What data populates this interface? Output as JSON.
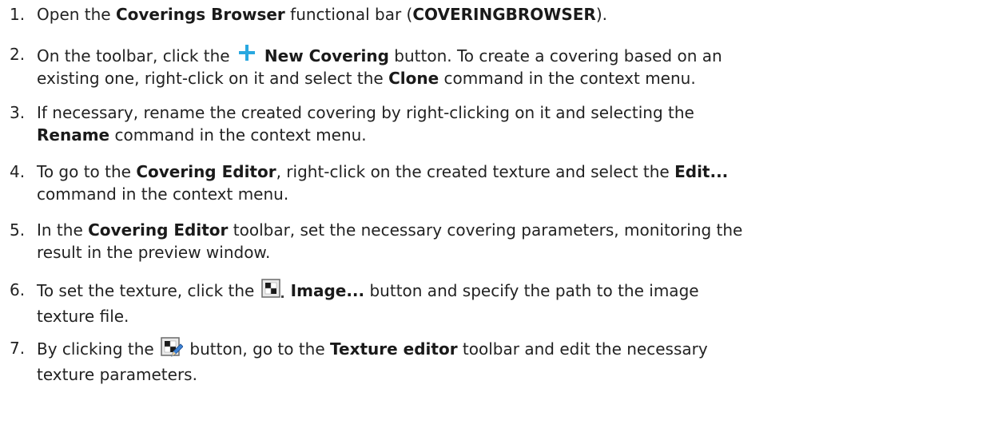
{
  "steps": [
    {
      "num": "1.",
      "lines": [
        [
          {
            "t": "Open the "
          },
          {
            "b": "Coverings Browser"
          },
          {
            "t": " functional bar ("
          },
          {
            "b": "COVERINGBROWSER"
          },
          {
            "t": ")."
          }
        ]
      ]
    },
    {
      "num": "2.",
      "lines": [
        [
          {
            "t": "On the toolbar, click the "
          },
          {
            "icon": "plus-icon"
          },
          {
            "b": " New Covering"
          },
          {
            "t": " button. To create a covering based on an"
          }
        ],
        [
          {
            "t": "existing one, right-click on it and select the "
          },
          {
            "b": "Clone"
          },
          {
            "t": " command in the context menu."
          }
        ]
      ]
    },
    {
      "num": "3.",
      "lines": [
        [
          {
            "t": "If necessary, rename the created covering by right-clicking on it and selecting the"
          }
        ],
        [
          {
            "b": "Rename"
          },
          {
            "t": " command in the context menu."
          }
        ]
      ]
    },
    {
      "num": "4.",
      "lines": [
        [
          {
            "t": "To go to the "
          },
          {
            "b": "Covering Editor"
          },
          {
            "t": ", right-click on the created texture and select the "
          },
          {
            "b": "Edit..."
          }
        ],
        [
          {
            "t": "command in the context menu."
          }
        ]
      ]
    },
    {
      "num": "5.",
      "lines": [
        [
          {
            "t": "In the "
          },
          {
            "b": "Covering Editor"
          },
          {
            "t": " toolbar, set the necessary covering parameters, monitoring the"
          }
        ],
        [
          {
            "t": "result in the preview window."
          }
        ]
      ]
    },
    {
      "num": "6.",
      "lines": [
        [
          {
            "t": "To set the texture, click the "
          },
          {
            "icon": "image-texture-icon"
          },
          {
            "b": " Image..."
          },
          {
            "t": " button and specify the path to the image"
          }
        ],
        [
          {
            "t": "texture file."
          }
        ]
      ]
    },
    {
      "num": "7.",
      "lines": [
        [
          {
            "t": "By clicking the "
          },
          {
            "icon": "edit-texture-icon"
          },
          {
            "t": " button, go to the "
          },
          {
            "b": "Texture editor"
          },
          {
            "t": " toolbar and edit the necessary"
          }
        ],
        [
          {
            "t": "texture parameters."
          }
        ]
      ]
    }
  ]
}
